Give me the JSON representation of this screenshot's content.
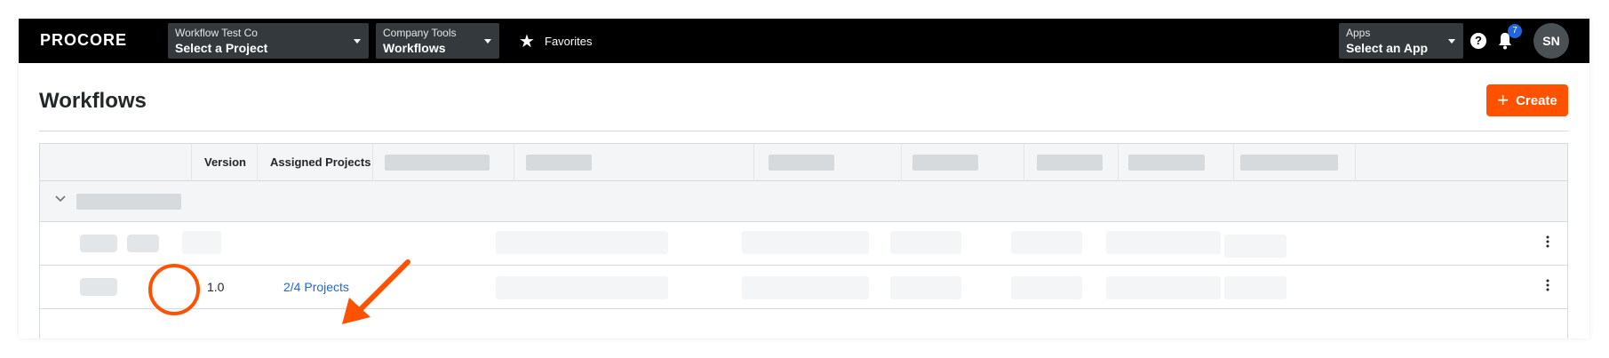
{
  "nav": {
    "logo": "PROCORE",
    "company_picker": {
      "caption": "Workflow Test Co",
      "value": "Select a Project"
    },
    "tools_picker": {
      "caption": "Company Tools",
      "value": "Workflows"
    },
    "favorites_label": "Favorites",
    "apps_picker": {
      "caption": "Apps",
      "value": "Select an App"
    },
    "help_glyph": "?",
    "notification_count": "7",
    "avatar_initials": "SN"
  },
  "header": {
    "title": "Workflows",
    "create_label": "Create"
  },
  "table": {
    "columns": [
      "Version",
      "Assigned Projects"
    ],
    "rows": [
      {
        "version": "",
        "assigned_projects": ""
      },
      {
        "version": "1.0",
        "assigned_projects": "2/4 Projects"
      }
    ]
  },
  "colors": {
    "brand_orange": "#ff5200",
    "link_blue": "#2066df",
    "nav_bg": "#000000"
  },
  "icons": [
    "star-icon",
    "help-icon",
    "bell-icon",
    "chevron-down-icon",
    "kebab-menu-icon",
    "plus-icon",
    "caret-down-icon"
  ]
}
